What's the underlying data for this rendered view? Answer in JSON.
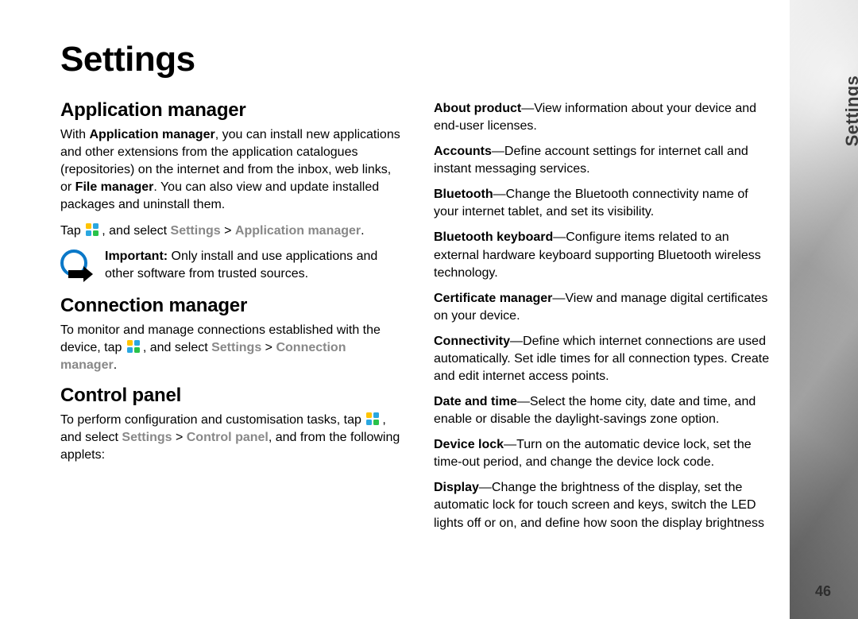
{
  "side": {
    "label": "Settings",
    "page": "46"
  },
  "title": "Settings",
  "sections": {
    "app_mgr": {
      "heading": "Application manager",
      "p1a": "With ",
      "p1b": "Application manager",
      "p1c": ", you can install new applications and other extensions from the application catalogues (repositories) on the internet and from the inbox, web links, or ",
      "p1d": "File manager",
      "p1e": ". You can also view and update installed packages and uninstall them.",
      "p2a": "Tap ",
      "p2b": ", and select ",
      "p2c": "Settings",
      "p2d": " > ",
      "p2e": "Application manager",
      "p2f": ".",
      "imp_label": "Important:",
      "imp_text": " Only install and use applications and other software from trusted sources."
    },
    "conn_mgr": {
      "heading": "Connection manager",
      "p1a": "To monitor and manage connections established with the device, tap ",
      "p1b": ", and select ",
      "p1c": "Settings",
      "p1d": " > ",
      "p1e": "Connection manager",
      "p1f": "."
    },
    "ctrl_panel": {
      "heading": "Control panel",
      "p1a": "To perform configuration and customisation tasks, tap ",
      "p1b": ", and select ",
      "p1c": "Settings",
      "p1d": " > ",
      "p1e": "Control panel",
      "p1f": ", and from the following applets:"
    }
  },
  "applets": {
    "about": {
      "name": "About product",
      "desc": "—View information about your device and end-user licenses."
    },
    "accounts": {
      "name": "Accounts",
      "desc": "—Define account settings for internet call and instant messaging services."
    },
    "bluetooth": {
      "name": "Bluetooth",
      "desc": "—Change the Bluetooth connectivity name of your internet tablet, and set its visibility."
    },
    "btkb": {
      "name": "Bluetooth keyboard",
      "desc": "—Configure items related to an external hardware keyboard supporting Bluetooth wireless technology."
    },
    "cert": {
      "name": "Certificate manager",
      "desc": "—View and manage digital certificates on your device."
    },
    "connect": {
      "name": "Connectivity",
      "desc": "—Define which internet connections are used automatically. Set idle times for all connection types. Create and edit internet access points."
    },
    "datetime": {
      "name": "Date and time",
      "desc": "—Select the home city, date and time, and enable or disable the daylight-savings zone option."
    },
    "devlock": {
      "name": "Device lock",
      "desc": "—Turn on the automatic device lock, set the time-out period, and change the device lock code."
    },
    "display": {
      "name": "Display",
      "desc": "—Change the brightness of the display, set the automatic lock for touch screen and keys, switch the LED lights off or on, and define how soon the display brightness"
    }
  }
}
